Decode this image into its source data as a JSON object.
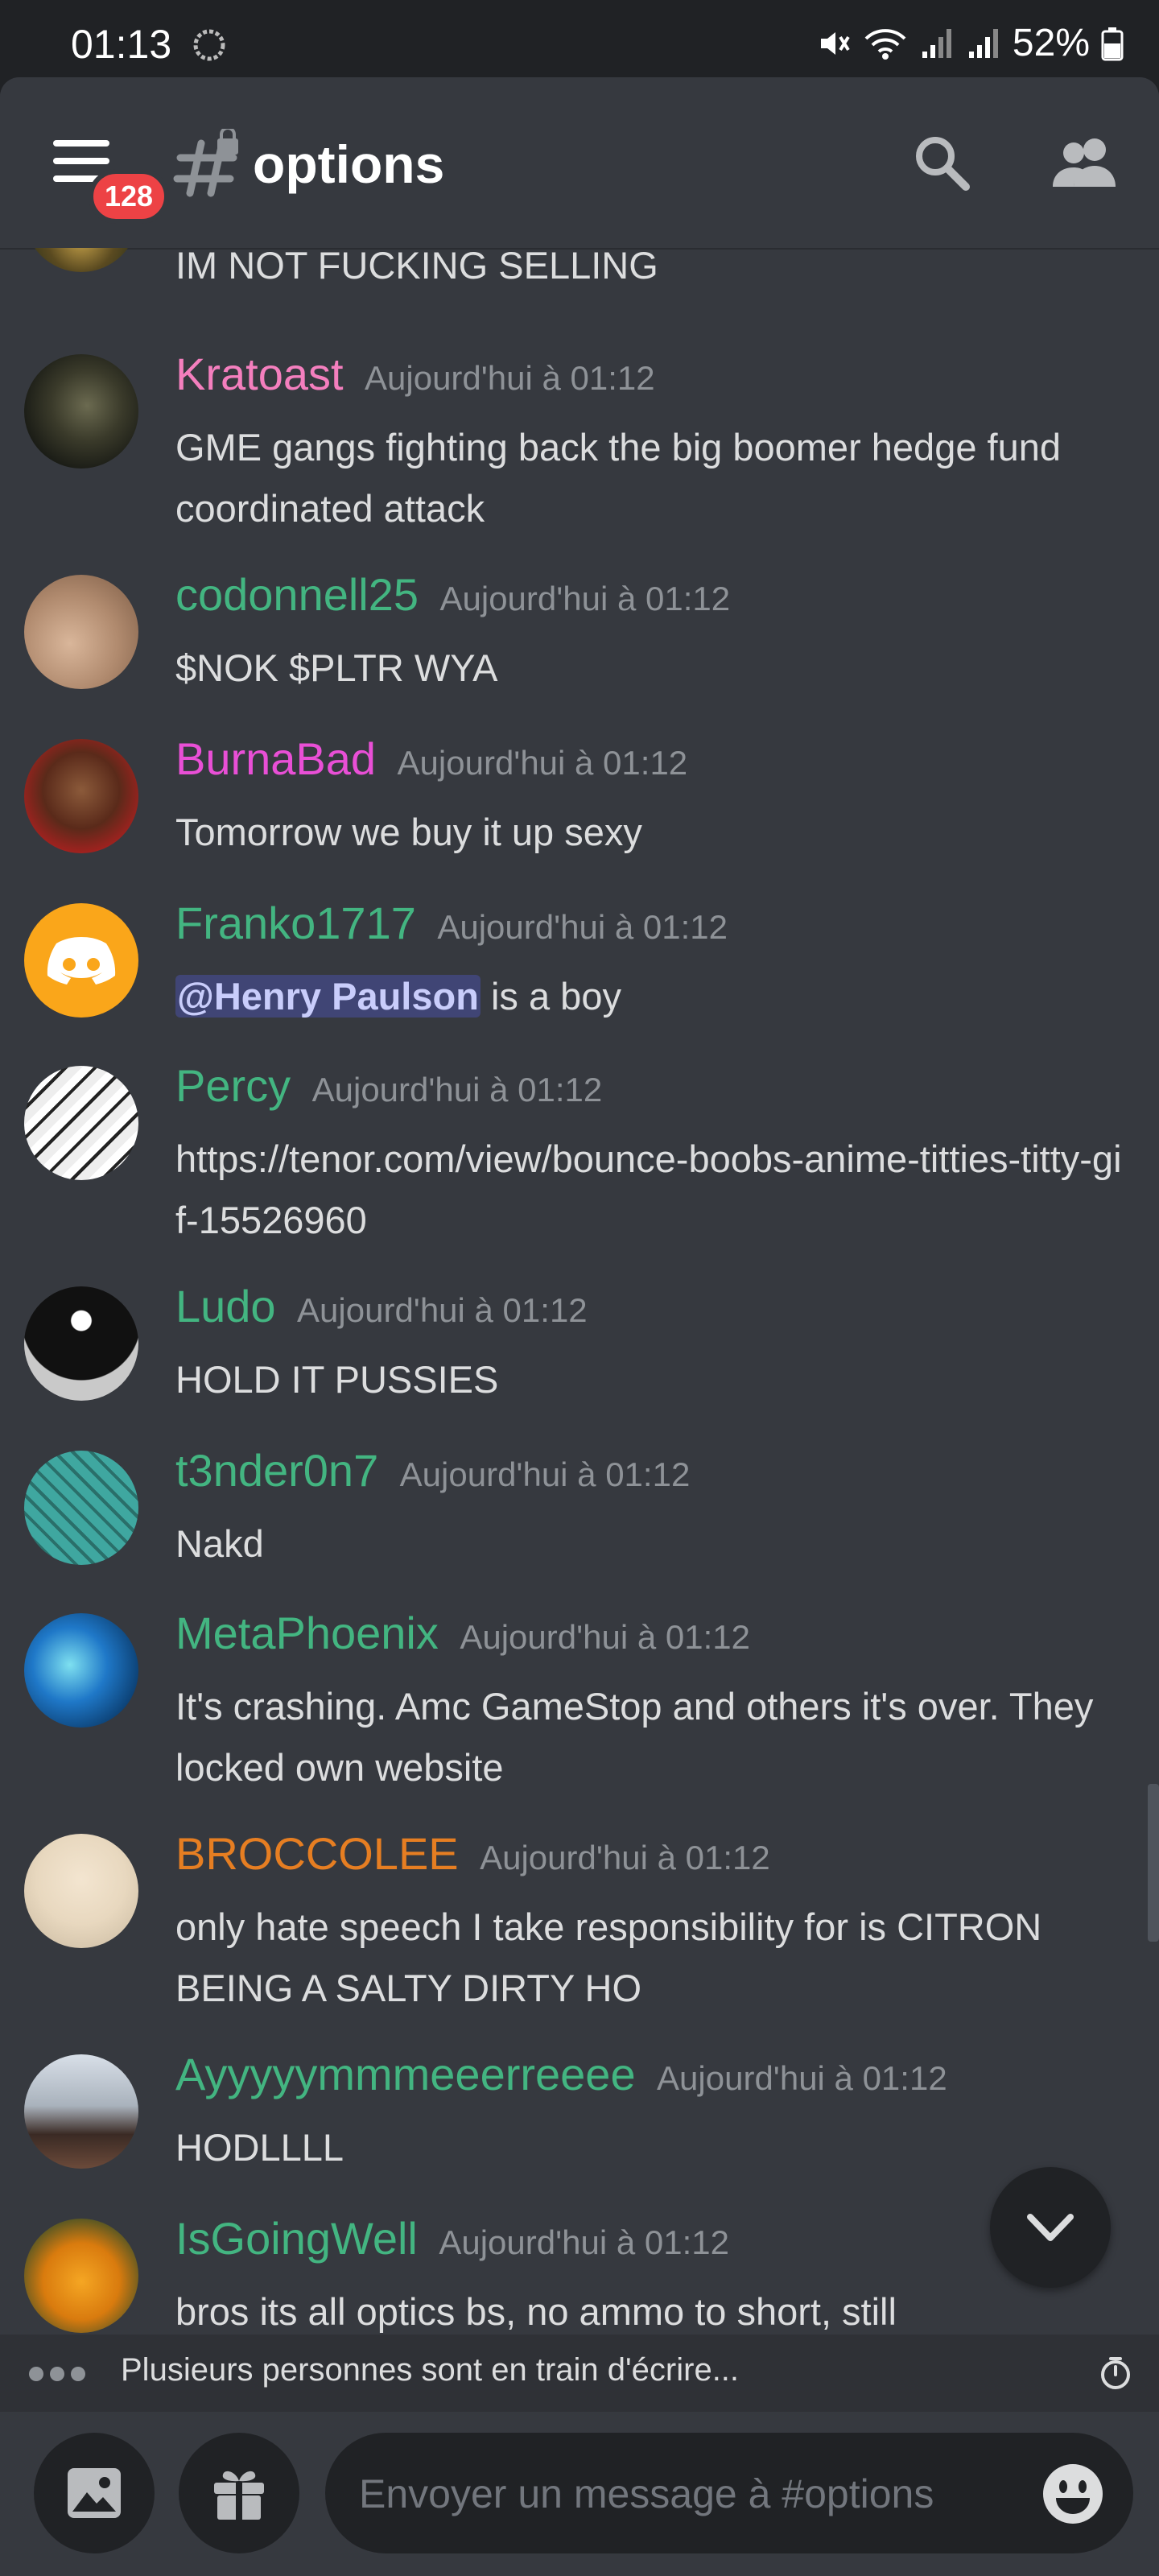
{
  "status_bar": {
    "time": "01:13",
    "battery": "52%"
  },
  "header": {
    "notification_count": "128",
    "channel_name": "options"
  },
  "messages": [
    {
      "author": "",
      "time": "",
      "text": "IM NOT FUCKING SELLING"
    },
    {
      "author": "Kratoast",
      "time": "Aujourd'hui à 01:12",
      "text": "GME gangs fighting back the big boomer hedge fund coordinated attack",
      "color": "#f47fbe"
    },
    {
      "author": "codonnell25",
      "time": "Aujourd'hui à 01:12",
      "text": "$NOK $PLTR WYA",
      "color": "#43b581"
    },
    {
      "author": "BurnaBad",
      "time": "Aujourd'hui à 01:12",
      "text": "Tomorrow we buy it up sexy",
      "color": "#e94fd6"
    },
    {
      "author": "Franko1717",
      "time": "Aujourd'hui à 01:12",
      "mention": "@Henry Paulson",
      "text": " is a boy",
      "color": "#43b581"
    },
    {
      "author": "Percy",
      "time": "Aujourd'hui à 01:12",
      "link": "https://tenor.com/view/bounce-boobs-anime-titties-titty-gif-15526960",
      "color": "#43b581"
    },
    {
      "author": "Ludo",
      "time": "Aujourd'hui à 01:12",
      "text": "HOLD IT PUSSIES",
      "color": "#43b581"
    },
    {
      "author": "t3nder0n7",
      "time": "Aujourd'hui à 01:12",
      "text": "Nakd",
      "color": "#43b581"
    },
    {
      "author": "MetaPhoenix",
      "time": "Aujourd'hui à 01:12",
      "text": "It's crashing. Amc GameStop and others it's over. They locked own website",
      "color": "#43b581"
    },
    {
      "author": "BROCCOLEE",
      "time": "Aujourd'hui à 01:12",
      "text": "only hate speech I take responsibility for is CITRON BEING A SALTY DIRTY HO",
      "color": "#e67e22"
    },
    {
      "author": "Ayyyyymmmeeerreeee",
      "time": "Aujourd'hui à 01:12",
      "text": "HODLLLL",
      "color": "#43b581"
    },
    {
      "author": "IsGoingWell",
      "time": "Aujourd'hui à 01:12",
      "text": "bros its all optics bs, no ammo to short, still",
      "color": "#43b581"
    }
  ],
  "typing_indicator": "Plusieurs personnes sont en train d'écrire...",
  "composer": {
    "placeholder": "Envoyer un message à #options"
  },
  "icons": {
    "menu": "hamburger-icon",
    "channel": "text-channel-locked-icon",
    "search": "search-icon",
    "members": "members-icon",
    "jump": "chevron-down-icon",
    "image": "image-icon",
    "gift": "gift-icon",
    "emoji": "emoji-icon",
    "slowmode": "timer-icon"
  }
}
